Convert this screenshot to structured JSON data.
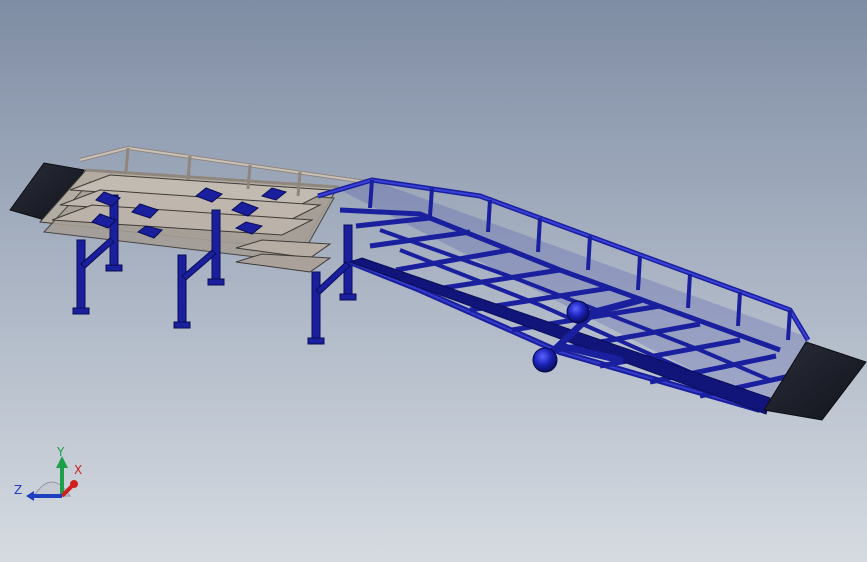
{
  "view": {
    "background_top": "#7f8da4",
    "background_bottom": "#d6dbe1",
    "model": {
      "ramp_color": "#1a1f9e",
      "platform_color": "#b3aca3",
      "plate_color": "#1e2230"
    },
    "triad": {
      "x_label": "X",
      "y_label": "Y",
      "z_label": "Z",
      "x_color": "#d11f1f",
      "y_color": "#1ea04a",
      "z_color": "#1d3fbf"
    }
  }
}
